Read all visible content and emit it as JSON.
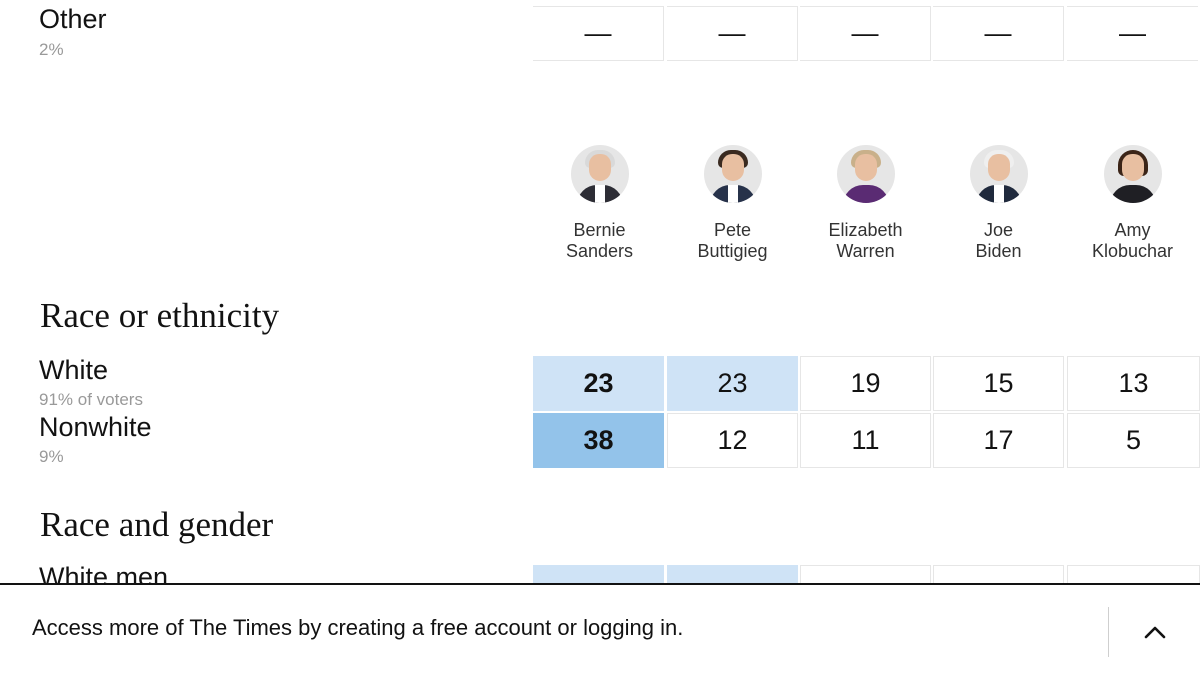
{
  "top_row": {
    "label": "Other",
    "share": "2%",
    "values": [
      "—",
      "—",
      "—",
      "—",
      "—"
    ]
  },
  "candidates": [
    {
      "first": "Bernie",
      "last": "Sanders"
    },
    {
      "first": "Pete",
      "last": "Buttigieg"
    },
    {
      "first": "Elizabeth",
      "last": "Warren"
    },
    {
      "first": "Joe",
      "last": "Biden"
    },
    {
      "first": "Amy",
      "last": "Klobuchar"
    }
  ],
  "sections": {
    "race": {
      "title": "Race or ethnicity",
      "rows": [
        {
          "label": "White",
          "share": "91% of voters",
          "values": [
            "23",
            "23",
            "19",
            "15",
            "13"
          ]
        },
        {
          "label": "Nonwhite",
          "share": "9%",
          "values": [
            "38",
            "12",
            "11",
            "17",
            "5"
          ]
        }
      ]
    },
    "gender": {
      "title": "Race and gender",
      "rows": [
        {
          "label": "White men"
        }
      ]
    }
  },
  "colors": {
    "highlight_light": "#cfe3f6",
    "highlight_strong": "#93c3ea",
    "cell_border": "#e6e6e6"
  },
  "icons": {
    "avatar": "candidate-portrait",
    "expand": "chevron-up-icon"
  },
  "bottom_bar": {
    "message": "Access more of The Times by creating a free account or logging in."
  }
}
